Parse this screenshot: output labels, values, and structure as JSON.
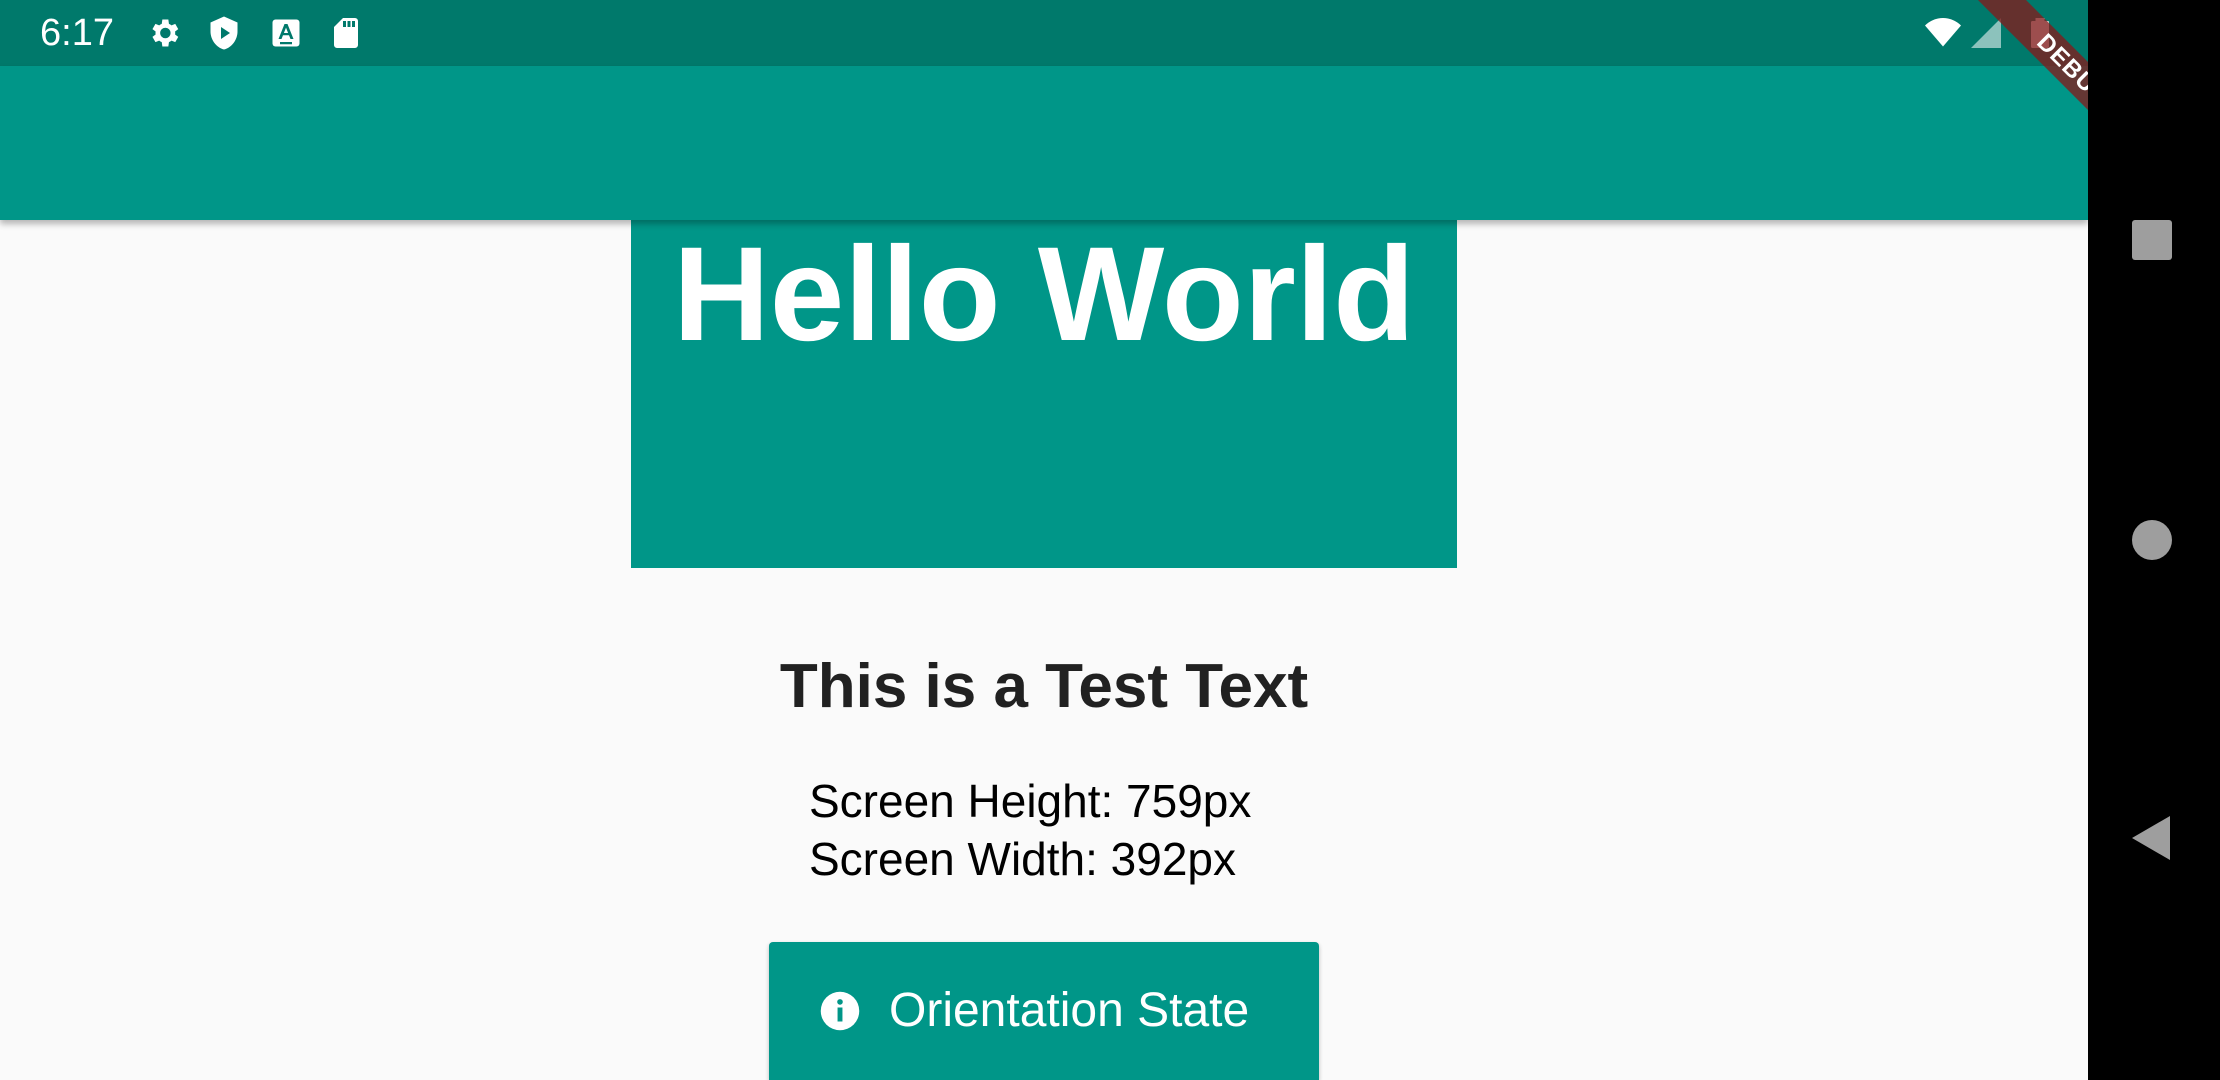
{
  "status_bar": {
    "time": "6:17",
    "icons": [
      "settings-icon",
      "play-protect-icon",
      "keyboard-a-icon",
      "sd-card-icon",
      "wifi-icon",
      "signal-icon",
      "battery-icon"
    ]
  },
  "debug_banner": {
    "label": "DEBUG"
  },
  "hero": {
    "title": "Hello World"
  },
  "content": {
    "headline": "This is a Test Text",
    "screen_height": "Screen Height: 759px",
    "screen_width": "Screen Width: 392px"
  },
  "orientation_button": {
    "icon": "info-icon",
    "label": "Orientation State"
  },
  "nav_bar": {
    "buttons": [
      "recents-square",
      "home-circle",
      "back-triangle"
    ]
  },
  "colors": {
    "primary": "#009688",
    "status_bar": "#00796b",
    "background": "#fafafa",
    "text_dark": "#212121",
    "nav_icon": "#9e9e9e"
  }
}
